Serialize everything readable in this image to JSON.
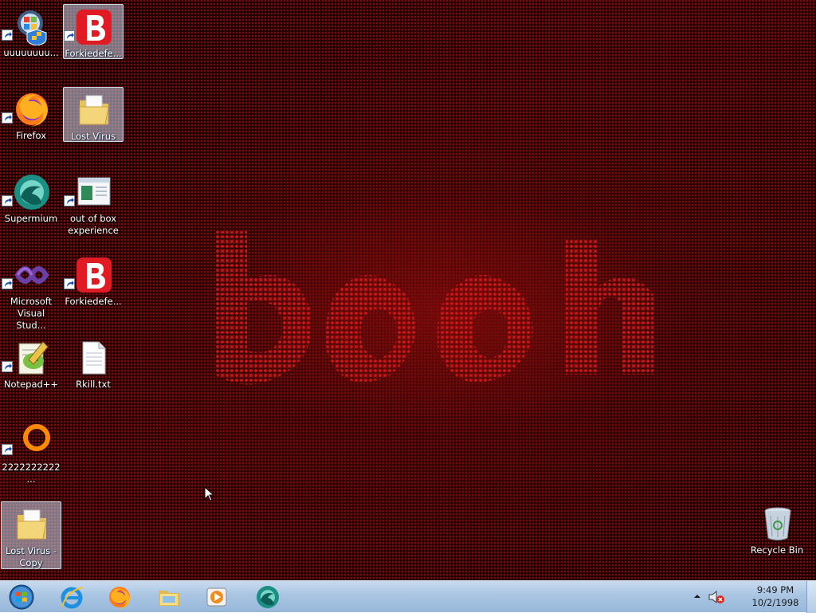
{
  "desktop": {
    "icons": [
      {
        "label": "uuuuuuuu...",
        "icon": "windows-update-icon",
        "selected": false
      },
      {
        "label": "Forkiedefe...",
        "icon": "bitdefender-icon",
        "selected": true
      },
      {
        "label": "Firefox",
        "icon": "firefox-icon",
        "selected": false
      },
      {
        "label": "Lost Virus",
        "icon": "folder-icon",
        "selected": true
      },
      {
        "label": "Supermium",
        "icon": "supermium-icon",
        "selected": false
      },
      {
        "label": "out of box experience",
        "icon": "window-app-icon",
        "selected": false
      },
      {
        "label": "Microsoft Visual Stud...",
        "icon": "visual-studio-icon",
        "selected": false
      },
      {
        "label": "Forkiedefe...",
        "icon": "bitdefender-icon",
        "selected": false
      },
      {
        "label": "Notepad++",
        "icon": "notepad-plus-plus-icon",
        "selected": false
      },
      {
        "label": "Rkill.txt",
        "icon": "text-file-icon",
        "selected": false
      },
      {
        "label": "2222222222...",
        "icon": "orange-ring-icon",
        "selected": false
      },
      {
        "label": "Lost Virus - Copy",
        "icon": "folder-icon",
        "selected": true
      },
      {
        "label": "Recycle Bin",
        "icon": "recycle-bin-icon",
        "selected": false
      }
    ]
  },
  "taskbar": {
    "pinned": [
      {
        "name": "internet-explorer-icon"
      },
      {
        "name": "firefox-icon"
      },
      {
        "name": "file-explorer-icon"
      },
      {
        "name": "media-player-icon"
      },
      {
        "name": "supermium-icon"
      }
    ],
    "tray": {
      "volume_icon": "volume-muted-icon",
      "show_hidden_icon": "chevron-up-icon"
    },
    "clock": {
      "time": "9:49 PM",
      "date": "10/2/1998"
    }
  },
  "colors": {
    "wallpaper_base": "#1a0203",
    "wallpaper_accent": "#c81414",
    "taskbar": "#a9c5e2",
    "selection": "#c8d7eb"
  }
}
